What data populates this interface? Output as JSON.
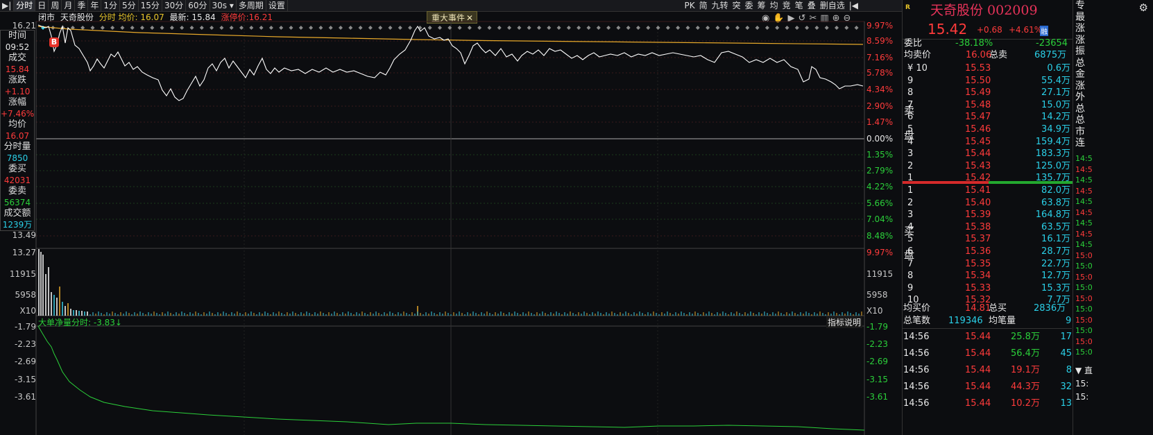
{
  "toolbar": {
    "left_items": [
      "▶|",
      "分时",
      "日",
      "周",
      "月",
      "季",
      "年",
      "1分",
      "5分",
      "15分",
      "30分",
      "60分",
      "30s ▾",
      "多周期",
      "设置"
    ],
    "right_items": [
      "PK",
      "简",
      "九转",
      "突",
      "委",
      "筹",
      "均",
      "竞",
      "笔",
      "叠",
      "删自选",
      "|◀"
    ]
  },
  "info": {
    "status": "闭市",
    "name": "天奇股份",
    "avg_label": "分时 均价: 16.07",
    "latest_label": "最新: 15.84",
    "limit_label": "涨停价:16.21",
    "event_tab": "重大事件"
  },
  "left_panel": {
    "time_label": "时间",
    "time": "09:52",
    "deal_label": "成交",
    "deal": "15.84",
    "change_label": "涨跌",
    "change": "+1.10",
    "pct_label": "涨幅",
    "pct": "+7.46%",
    "avg_label": "均价",
    "avg": "16.07",
    "vol_label": "分时量",
    "vol": "7850",
    "bid_label": "委买",
    "bid": "42031",
    "ask_label": "委卖",
    "ask": "56374",
    "amount_label": "成交额",
    "amount": "1239万"
  },
  "marker": "B",
  "price_axis": {
    "left_top": "16.21",
    "left_bottom": "13.49",
    "right": [
      "9.97%",
      "8.59%",
      "7.16%",
      "5.78%",
      "4.34%",
      "2.90%",
      "1.47%",
      "0.00%",
      "1.35%",
      "2.79%",
      "4.22%",
      "5.66%",
      "7.04%",
      "8.48%",
      "9.97%"
    ]
  },
  "volume_axis": {
    "left": [
      "13.27",
      "11915",
      "5958",
      "X10"
    ],
    "right": [
      "11915",
      "5958",
      "X10"
    ]
  },
  "indicator": {
    "title": "大单净量分时: -3.83↓",
    "explain": "指标说明",
    "left_axis": [
      "-1.79",
      "-2.23",
      "-2.69",
      "-3.15",
      "-3.61"
    ],
    "right_axis": [
      "-1.79",
      "-2.23",
      "-2.69",
      "-3.15",
      "-3.61"
    ]
  },
  "quote": {
    "badge": "R",
    "name": "天奇股份 002009",
    "price": "15.42",
    "change": "+0.68",
    "pct": "+4.61%",
    "tag": "融",
    "weibi_label": "委比",
    "weibi": "-38.18%",
    "weicha": "-23654",
    "avg_sell_label": "均卖价",
    "avg_sell": "16.06",
    "total_sell_label": "总卖",
    "total_sell": "6875万",
    "sell_side_label": [
      "卖",
      "盘"
    ],
    "buy_side_label": [
      "买",
      "盘"
    ],
    "sells": [
      {
        "lvl": "¥ 10",
        "price": "15.53",
        "vol": "0.6万"
      },
      {
        "lvl": "9",
        "price": "15.50",
        "vol": "55.4万"
      },
      {
        "lvl": "8",
        "price": "15.49",
        "vol": "27.1万"
      },
      {
        "lvl": "7",
        "price": "15.48",
        "vol": "15.0万"
      },
      {
        "lvl": "6",
        "price": "15.47",
        "vol": "14.2万"
      },
      {
        "lvl": "5",
        "price": "15.46",
        "vol": "34.9万"
      },
      {
        "lvl": "4",
        "price": "15.45",
        "vol": "159.4万"
      },
      {
        "lvl": "3",
        "price": "15.44",
        "vol": "183.3万"
      },
      {
        "lvl": "2",
        "price": "15.43",
        "vol": "125.0万"
      },
      {
        "lvl": "1",
        "price": "15.42",
        "vol": "135.7万"
      }
    ],
    "buys": [
      {
        "lvl": "1",
        "price": "15.41",
        "vol": "82.0万"
      },
      {
        "lvl": "2",
        "price": "15.40",
        "vol": "63.8万"
      },
      {
        "lvl": "3",
        "price": "15.39",
        "vol": "164.8万"
      },
      {
        "lvl": "4",
        "price": "15.38",
        "vol": "63.5万"
      },
      {
        "lvl": "5",
        "price": "15.37",
        "vol": "16.1万"
      },
      {
        "lvl": "6",
        "price": "15.36",
        "vol": "28.7万"
      },
      {
        "lvl": "7",
        "price": "15.35",
        "vol": "22.7万"
      },
      {
        "lvl": "8",
        "price": "15.34",
        "vol": "12.7万"
      },
      {
        "lvl": "9",
        "price": "15.33",
        "vol": "15.3万"
      },
      {
        "lvl": "10",
        "price": "15.32",
        "vol": "7.7万"
      }
    ],
    "avg_buy_label": "均买价",
    "avg_buy": "14.81",
    "total_buy_label": "总买",
    "total_buy": "2836万",
    "total_trades_label": "总笔数",
    "total_trades": "119346",
    "avg_trade_label": "均笔量",
    "avg_trade": "9",
    "ticks": [
      {
        "time": "14:56",
        "price": "15.44",
        "amount": "25.8万",
        "n": "17",
        "color": "#2bd03a"
      },
      {
        "time": "14:56",
        "price": "15.44",
        "amount": "56.4万",
        "n": "45",
        "color": "#2bd03a"
      },
      {
        "time": "14:56",
        "price": "15.44",
        "amount": "19.1万",
        "n": "8",
        "color": "#ff3b3b"
      },
      {
        "time": "14:56",
        "price": "15.44",
        "amount": "44.3万",
        "n": "32",
        "color": "#ff3b3b"
      },
      {
        "time": "14:56",
        "price": "15.44",
        "amount": "10.2万",
        "n": "13",
        "color": "#ff3b3b"
      }
    ]
  },
  "side_strip": {
    "chars": [
      "专",
      "最",
      "涨",
      "涨",
      "振",
      "总",
      "金",
      "涨",
      "外",
      "总",
      "总",
      "市",
      "连"
    ],
    "times": [
      "14:5",
      "14:5",
      "14:5",
      "14:5",
      "14:5",
      "14:5",
      "14:5",
      "14:5",
      "14:5",
      "15:0",
      "15:0",
      "15:0",
      "15:0",
      "15:0",
      "15:0",
      "15:0",
      "15:0",
      "15:0",
      "15:0"
    ],
    "bottom": [
      "▼ 直",
      "15:",
      "15:"
    ]
  },
  "colors": {
    "up": "#ff3b3b",
    "down": "#2bd03a",
    "avg_line": "#e8a92a",
    "price_line": "#ffffff",
    "bg": "#0c0d10"
  }
}
